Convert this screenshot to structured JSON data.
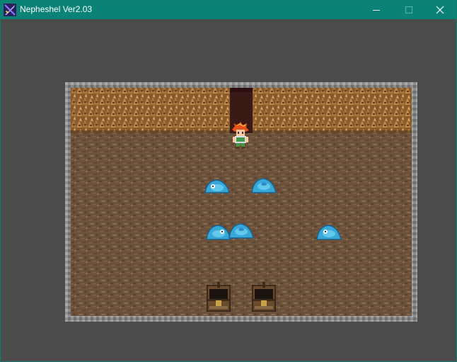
{
  "window": {
    "title": "Nepheshel Ver2.03",
    "controls": {
      "minimize": "minimize-icon",
      "maximize": "maximize-icon",
      "close": "close-icon"
    },
    "colors": {
      "titlebar": "#0b8276",
      "background": "#4b4b4b"
    }
  },
  "scene": {
    "type": "dungeon-room",
    "player": {
      "name": "player",
      "hair": "#e8501c"
    },
    "slimes": 5,
    "chests": 2,
    "exit": "north-doorway"
  }
}
